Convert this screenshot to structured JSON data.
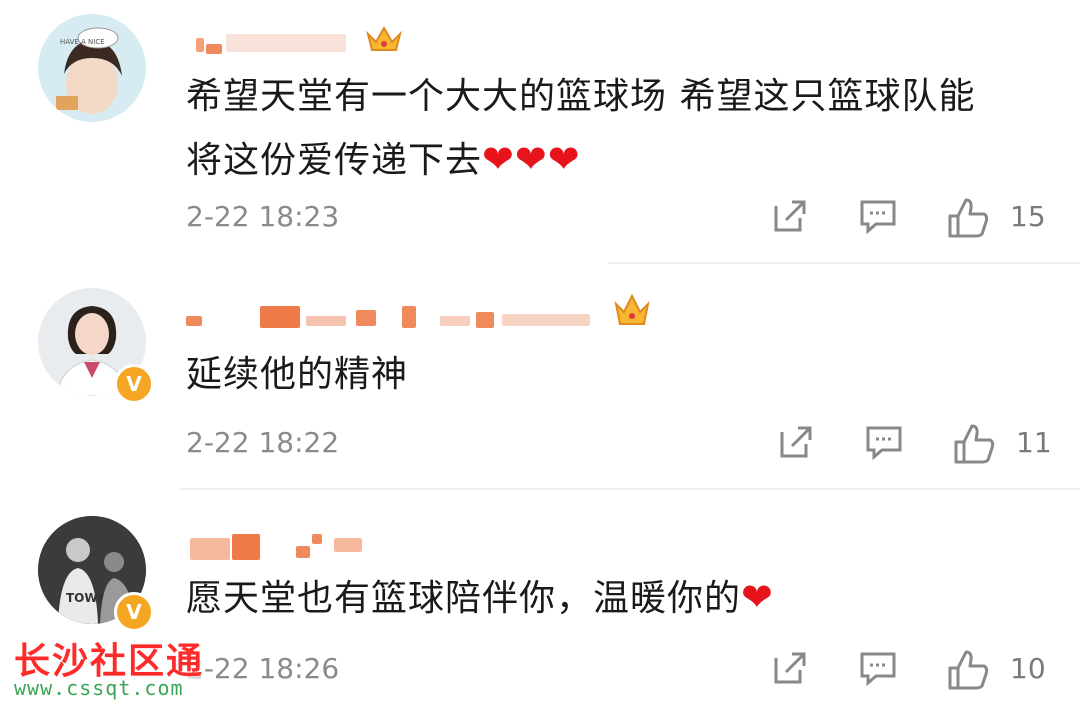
{
  "comments": [
    {
      "text_lines": [
        "希望天堂有一个大大的篮球场 希望这只篮球队能",
        "将这份爱传递下去"
      ],
      "hearts": 3,
      "time": "2-22 18:23",
      "likes": "15",
      "verified": false
    },
    {
      "text_lines": [
        "延续他的精神"
      ],
      "hearts": 0,
      "time": "2-22 18:22",
      "likes": "11",
      "verified": true
    },
    {
      "text_lines": [
        "愿天堂也有篮球陪伴你，温暖你的"
      ],
      "hearts": 1,
      "time": "2-22 18:26",
      "likes": "10",
      "verified": true
    }
  ],
  "icons": {
    "share": "share-icon",
    "reply": "comment-icon",
    "like": "thumbs-up-icon",
    "heart": "heart-emoji",
    "crown": "crown-icon",
    "verified_badge": "V"
  },
  "colors": {
    "heart": "#e8141c",
    "badge": "#f5a623",
    "watermark_text": "#ff2b2b",
    "watermark_url": "#3aa655"
  },
  "watermark": {
    "brand": "长沙社区通",
    "url": "www.cssqt.com"
  }
}
